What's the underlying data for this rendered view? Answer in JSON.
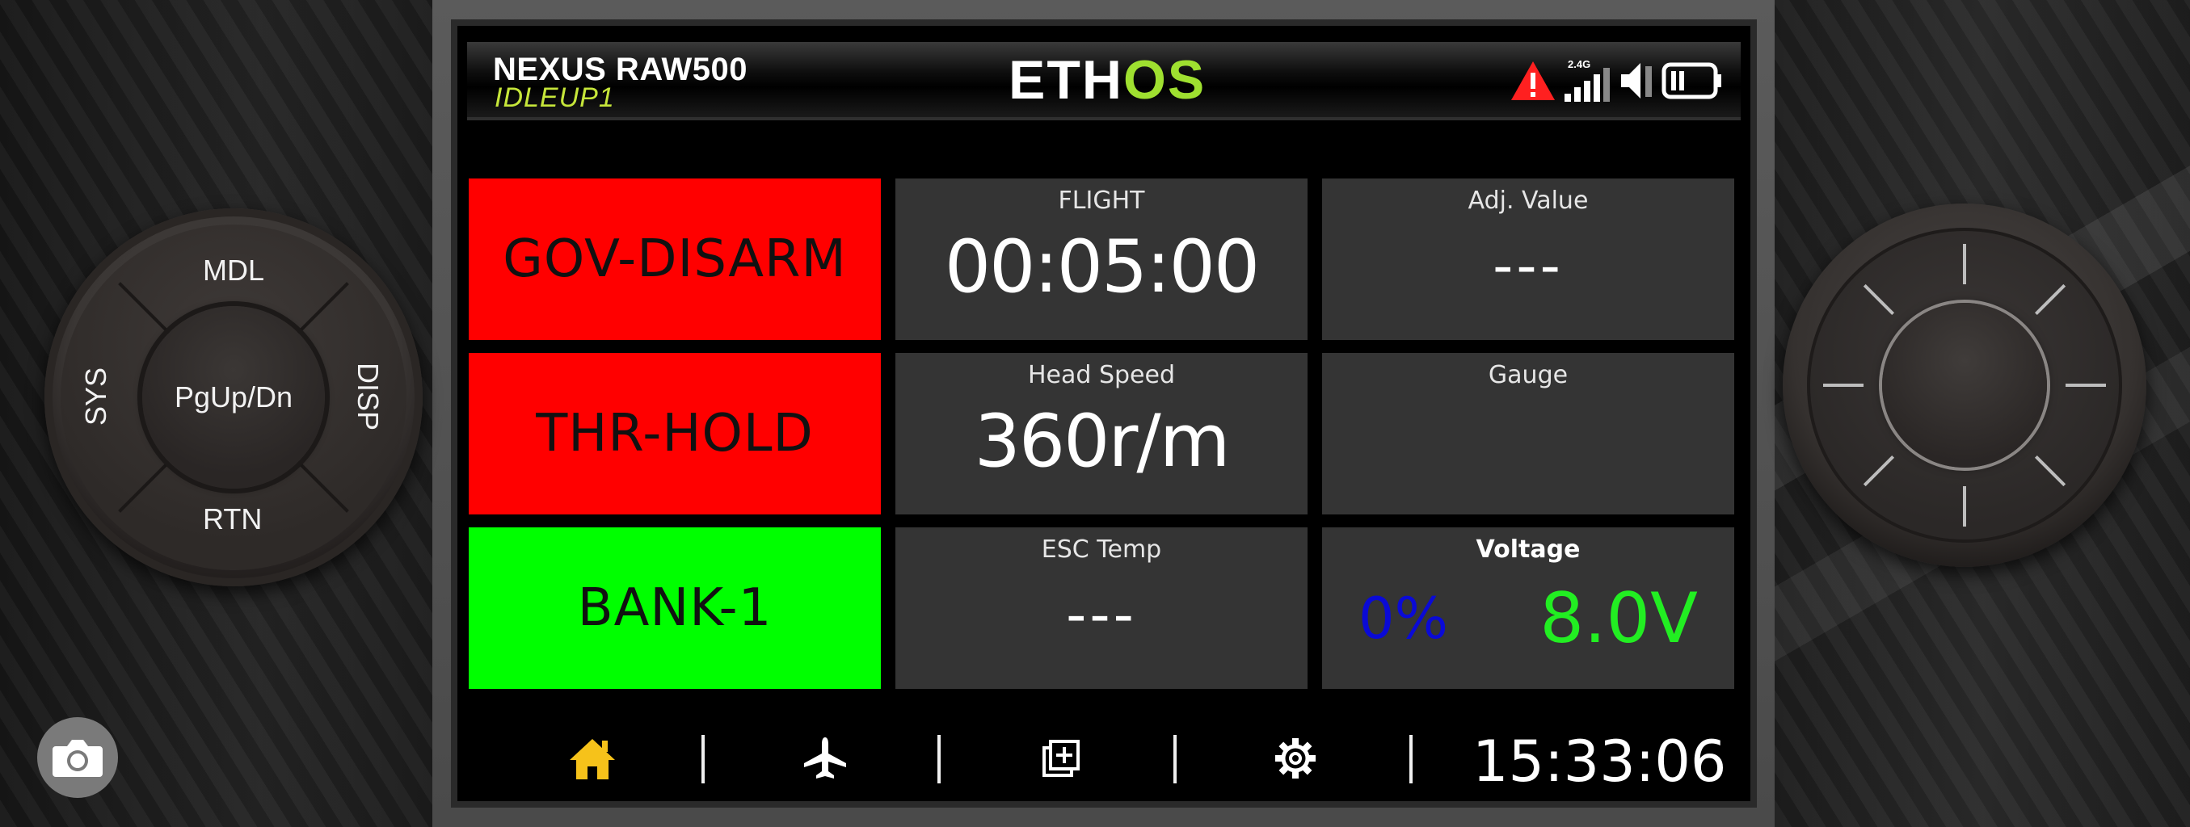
{
  "device": {
    "dpad": {
      "top_label": "MDL",
      "left_label": "SYS",
      "right_label": "DISP",
      "bottom_label": "RTN",
      "center_label": "PgUp/Dn"
    },
    "camera_icon": "camera-icon",
    "wheel_icon": "scroll-wheel"
  },
  "header": {
    "model_name": "NEXUS RAW500",
    "flight_mode": "IDLEUP1",
    "logo_part1": "ETH",
    "logo_part2": "OS",
    "status_icons": [
      "warning-icon",
      "signal-2.4g-icon",
      "volume-icon",
      "battery-icon"
    ],
    "signal_label": "2.4G",
    "colors": {
      "flight_mode": "#c6e63a",
      "logo_accent": "#9fe030",
      "warning": "#ff2020"
    }
  },
  "tiles": {
    "gov": {
      "label": "GOV-DISARM",
      "color": "#ff0000"
    },
    "thr": {
      "label": "THR-HOLD",
      "color": "#ff0000"
    },
    "bank": {
      "label": "BANK-1",
      "color": "#00ff00"
    },
    "flight": {
      "caption": "FLIGHT",
      "value": "00:05:00"
    },
    "adj": {
      "caption": "Adj. Value",
      "value": "---"
    },
    "headspeed": {
      "caption": "Head Speed",
      "value": "360r/m"
    },
    "gauge": {
      "caption": "Gauge",
      "value": ""
    },
    "esc": {
      "caption": "ESC Temp",
      "value": "---"
    },
    "voltage": {
      "caption": "Voltage",
      "percent": "0%",
      "value": "8.0V",
      "percent_color": "#0a0ad6",
      "value_color": "#22ee22"
    }
  },
  "nav": {
    "items": [
      "home-icon",
      "airplane-icon",
      "add-widget-icon",
      "settings-icon"
    ],
    "active_color": "#f6c21a",
    "clock": "15:33:06"
  }
}
